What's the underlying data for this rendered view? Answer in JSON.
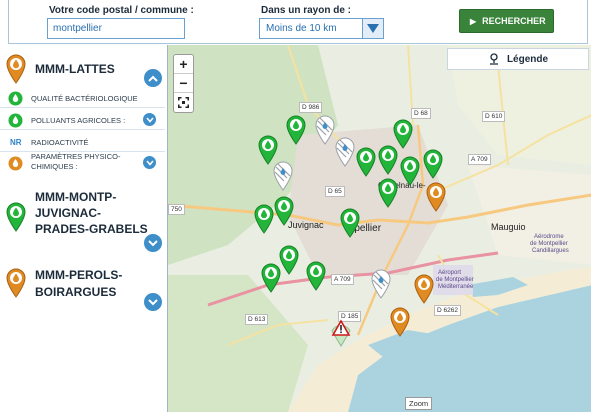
{
  "search": {
    "postal_label": "Votre code postal / commune :",
    "postal_value": "montpellier",
    "radius_label": "Dans un rayon de :",
    "radius_value": "Moins de 10 km",
    "button_label": "RECHERCHER"
  },
  "sidebar": {
    "stations": [
      {
        "name": "MMM-LATTES",
        "pin": "orange",
        "expanded": true
      },
      {
        "name": "MMM-MONTP-JUVIGNAC-PRADES-GRABELS",
        "name_lines": [
          "MMM-MONTP-",
          "JUVIGNAC-",
          "PRADES-GRABELS"
        ],
        "pin": "green",
        "expanded": false
      },
      {
        "name": "MMM-PEROLS-BOIRARGUES",
        "name_lines": [
          "MMM-PEROLS-",
          "BOIRARGUES"
        ],
        "pin": "orange",
        "expanded": false
      }
    ],
    "parameters": [
      {
        "label": "QUALITÉ BACTÉRIOLOGIQUE",
        "icon": "green-drop-icon",
        "expandable": false
      },
      {
        "label": "POLLUANTS AGRICOLES :",
        "icon": "green-drop-icon",
        "expandable": true
      },
      {
        "label": "RADIOACTIVITÉ",
        "icon": "NR",
        "expandable": false
      },
      {
        "label_lines": [
          "PARAMÈTRES PHYSICO-",
          "CHIMIQUES :"
        ],
        "label": "PARAMÈTRES PHYSICO-CHIMIQUES :",
        "icon": "orange-drop-icon",
        "expandable": true
      }
    ]
  },
  "map": {
    "legend_label": "Légende",
    "zoom_in": "+",
    "zoom_out": "−",
    "zoom_caption": "Zoom",
    "cities": [
      "Juvignac",
      "Montpellier",
      "Mauguio",
      "Castelnau-le-Lez"
    ],
    "city_partial": {
      "montpellier": "ntpellier",
      "castelnau": "Castelnau-le-",
      "airport_lines": [
        "Aéroport",
        "de Montpellier",
        "Méditerranée"
      ],
      "aero_lines": [
        "Aérodrome",
        "de Montpellier",
        "Candillargues"
      ]
    },
    "roads": [
      "D 986",
      "D 68",
      "D 610",
      "A 709",
      "D 65",
      "750",
      "A 709",
      "D 613",
      "D 6262",
      "D 185"
    ],
    "colors": {
      "green": "#22b53a",
      "orange": "#e08a22",
      "sea": "#aad3df",
      "accent": "#3d8ec9"
    }
  }
}
